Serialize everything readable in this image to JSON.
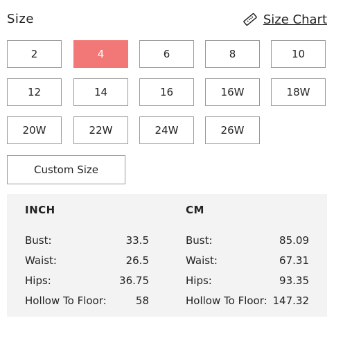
{
  "header": {
    "title": "Size",
    "size_chart_label": "Size Chart",
    "size_chart_icon": "ruler-icon"
  },
  "sizes": {
    "options": [
      "2",
      "4",
      "6",
      "8",
      "10",
      "12",
      "14",
      "16",
      "16W",
      "18W",
      "20W",
      "22W",
      "24W",
      "26W"
    ],
    "selected": "4",
    "selected_color": "#f27878",
    "custom_label": "Custom Size"
  },
  "measurements": {
    "inch": {
      "title": "INCH",
      "rows": [
        {
          "label": "Bust:",
          "value": "33.5"
        },
        {
          "label": "Waist:",
          "value": "26.5"
        },
        {
          "label": "Hips:",
          "value": "36.75"
        },
        {
          "label": "Hollow To Floor:",
          "value": "58"
        }
      ]
    },
    "cm": {
      "title": "CM",
      "rows": [
        {
          "label": "Bust:",
          "value": "85.09"
        },
        {
          "label": "Waist:",
          "value": "67.31"
        },
        {
          "label": "Hips:",
          "value": "93.35"
        },
        {
          "label": "Hollow To Floor:",
          "value": "147.32"
        }
      ]
    }
  }
}
